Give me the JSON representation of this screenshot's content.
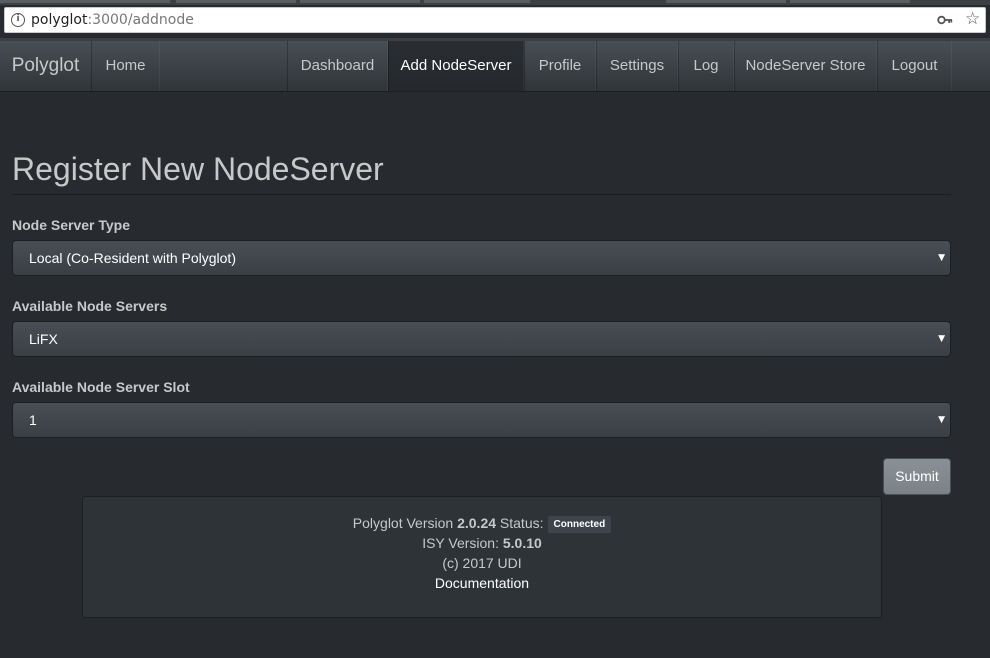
{
  "browser": {
    "url_host": "polyglot",
    "url_rest": ":3000/addnode",
    "info_icon": "info-icon",
    "key_icon": "key-icon",
    "star_icon": "star-icon",
    "info_glyph": "i",
    "star_glyph": "☆"
  },
  "navbar": {
    "brand": "Polyglot",
    "home": "Home",
    "items": [
      {
        "label": "Dashboard"
      },
      {
        "label": "Add NodeServer",
        "active": true
      },
      {
        "label": "Profile"
      },
      {
        "label": "Settings"
      },
      {
        "label": "Log"
      },
      {
        "label": "NodeServer Store"
      },
      {
        "label": "Logout"
      }
    ]
  },
  "page": {
    "title": "Register New NodeServer"
  },
  "form": {
    "type_label": "Node Server Type",
    "type_value": "Local (Co-Resident with Polyglot)",
    "servers_label": "Available Node Servers",
    "servers_value": "LiFX",
    "slot_label": "Available Node Server Slot",
    "slot_value": "1",
    "caret": "▼",
    "submit_label": "Submit"
  },
  "footer": {
    "version_prefix": "Polyglot Version",
    "version": "2.0.24",
    "status_prefix": "Status:",
    "status_badge": "Connected",
    "isy_prefix": "ISY Version:",
    "isy_version": "5.0.10",
    "copyright": "(c) 2017 UDI",
    "doc_link": "Documentation"
  },
  "colors": {
    "background": "#272b30",
    "navbar": "#3a3f44",
    "active_nav": "#25282c",
    "submit_button": "#7a8288",
    "footer_panel": "#2e3338"
  }
}
